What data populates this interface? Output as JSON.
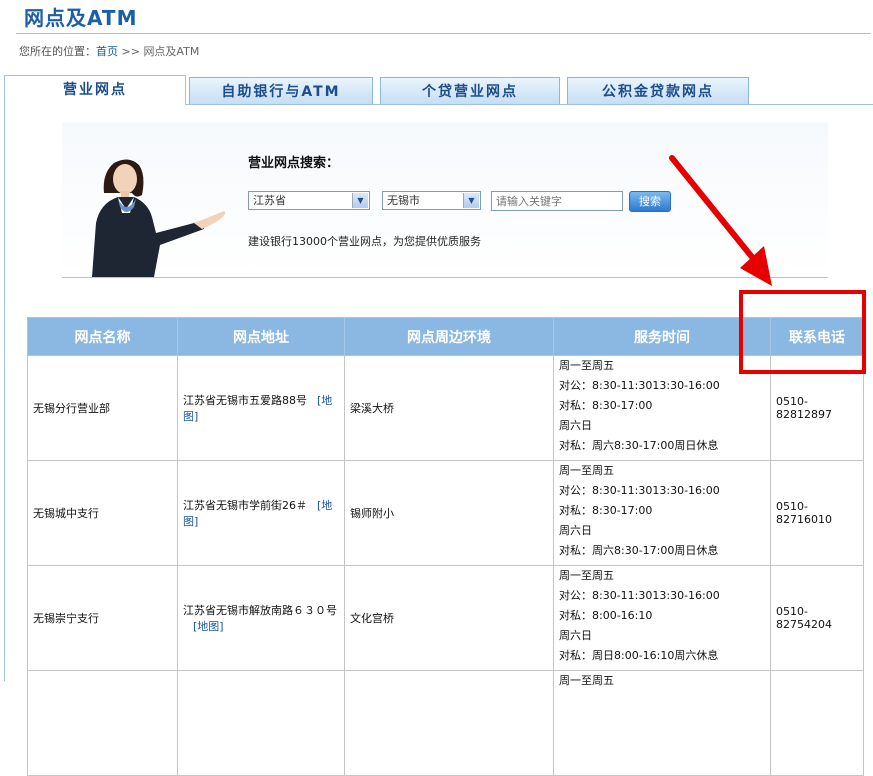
{
  "header": {
    "title": "网点及ATM",
    "breadcrumb_prefix": "您所在的位置：",
    "breadcrumb_home": "首页",
    "breadcrumb_sep": ">>",
    "breadcrumb_current": "网点及ATM"
  },
  "tabs": [
    {
      "label": "营业网点",
      "active": true
    },
    {
      "label": "自助银行与ATM",
      "active": false
    },
    {
      "label": "个贷营业网点",
      "active": false
    },
    {
      "label": "公积金贷款网点",
      "active": false
    }
  ],
  "search": {
    "title": "营业网点搜索：",
    "province": "江苏省",
    "city": "无锡市",
    "keyword_placeholder": "请输入关键字",
    "button_label": "搜索",
    "tagline": "建设银行13000个营业网点，为您提供优质服务"
  },
  "table": {
    "headers": [
      "网点名称",
      "网点地址",
      "网点周边环境",
      "服务时间",
      "联系电话"
    ],
    "map_label": "[地图]",
    "rows": [
      {
        "name": "无锡分行营业部",
        "address": "江苏省无锡市五爱路88号",
        "env": "梁溪大桥",
        "service": [
          "周一至周五",
          "对公：8:30-11:3013:30-16:00",
          "对私：8:30-17:00",
          "周六日",
          "对私：周六8:30-17:00周日休息"
        ],
        "phone": "0510-82812897"
      },
      {
        "name": "无锡城中支行",
        "address": "江苏省无锡市学前街26＃",
        "env": "锡师附小",
        "service": [
          "周一至周五",
          "对公：8:30-11:3013:30-16:00",
          "对私：8:30-17:00",
          "周六日",
          "对私：周六8:30-17:00周日休息"
        ],
        "phone": "0510-82716010"
      },
      {
        "name": "无锡崇宁支行",
        "address": "江苏省无锡市解放南路６３０号",
        "env": "文化宫桥",
        "service": [
          "周一至周五",
          "对公：8:30-11:3013:30-16:00",
          "对私：8:00-16:10",
          "周六日",
          "对私：周日8:00-16:10周六休息"
        ],
        "phone": "0510-82754204"
      },
      {
        "name": "",
        "address": "",
        "env": "",
        "service": [
          "周一至周五"
        ],
        "phone": ""
      }
    ]
  },
  "annotation": {
    "color": "#e60000"
  }
}
